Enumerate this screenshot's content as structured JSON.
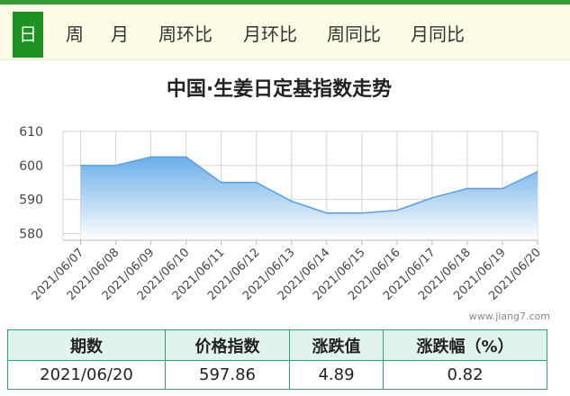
{
  "tabs": [
    {
      "label": "日",
      "active": true
    },
    {
      "label": "周",
      "active": false
    },
    {
      "label": "月",
      "active": false
    },
    {
      "label": "周环比",
      "active": false
    },
    {
      "label": "月环比",
      "active": false
    },
    {
      "label": "周同比",
      "active": false
    },
    {
      "label": "月同比",
      "active": false
    }
  ],
  "colors": {
    "active_tab": "#1f9322",
    "line": "#5aa0e0",
    "area_top": "#6aaee8",
    "area_bottom": "#ffffff",
    "grid": "#d4d4d4",
    "table_border": "#2e9e87",
    "table_header_bg": "#e2f3ee"
  },
  "chart_data": {
    "type": "area",
    "title": "中国·生姜日定基指数走势",
    "categories": [
      "2021/06/07",
      "2021/06/08",
      "2021/06/09",
      "2021/06/10",
      "2021/06/11",
      "2021/06/12",
      "2021/06/13",
      "2021/06/14",
      "2021/06/15",
      "2021/06/16",
      "2021/06/17",
      "2021/06/18",
      "2021/06/19",
      "2021/06/20"
    ],
    "series": [
      {
        "values": [
          600.0,
          600.0,
          602.5,
          602.5,
          595.0,
          595.0,
          589.5,
          586.0,
          586.0,
          586.8,
          590.5,
          593.2,
          593.2,
          598.2
        ]
      }
    ],
    "yticks": [
      580,
      590,
      600,
      610
    ],
    "ylim": [
      578,
      610
    ],
    "grid": true,
    "legend": "none",
    "watermark": "www.jiang7.com"
  },
  "table": {
    "headers": [
      "期数",
      "价格指数",
      "涨跌值",
      "涨跌幅（%）"
    ],
    "rows": [
      [
        "2021/06/20",
        "597.86",
        "4.89",
        "0.82"
      ]
    ]
  }
}
